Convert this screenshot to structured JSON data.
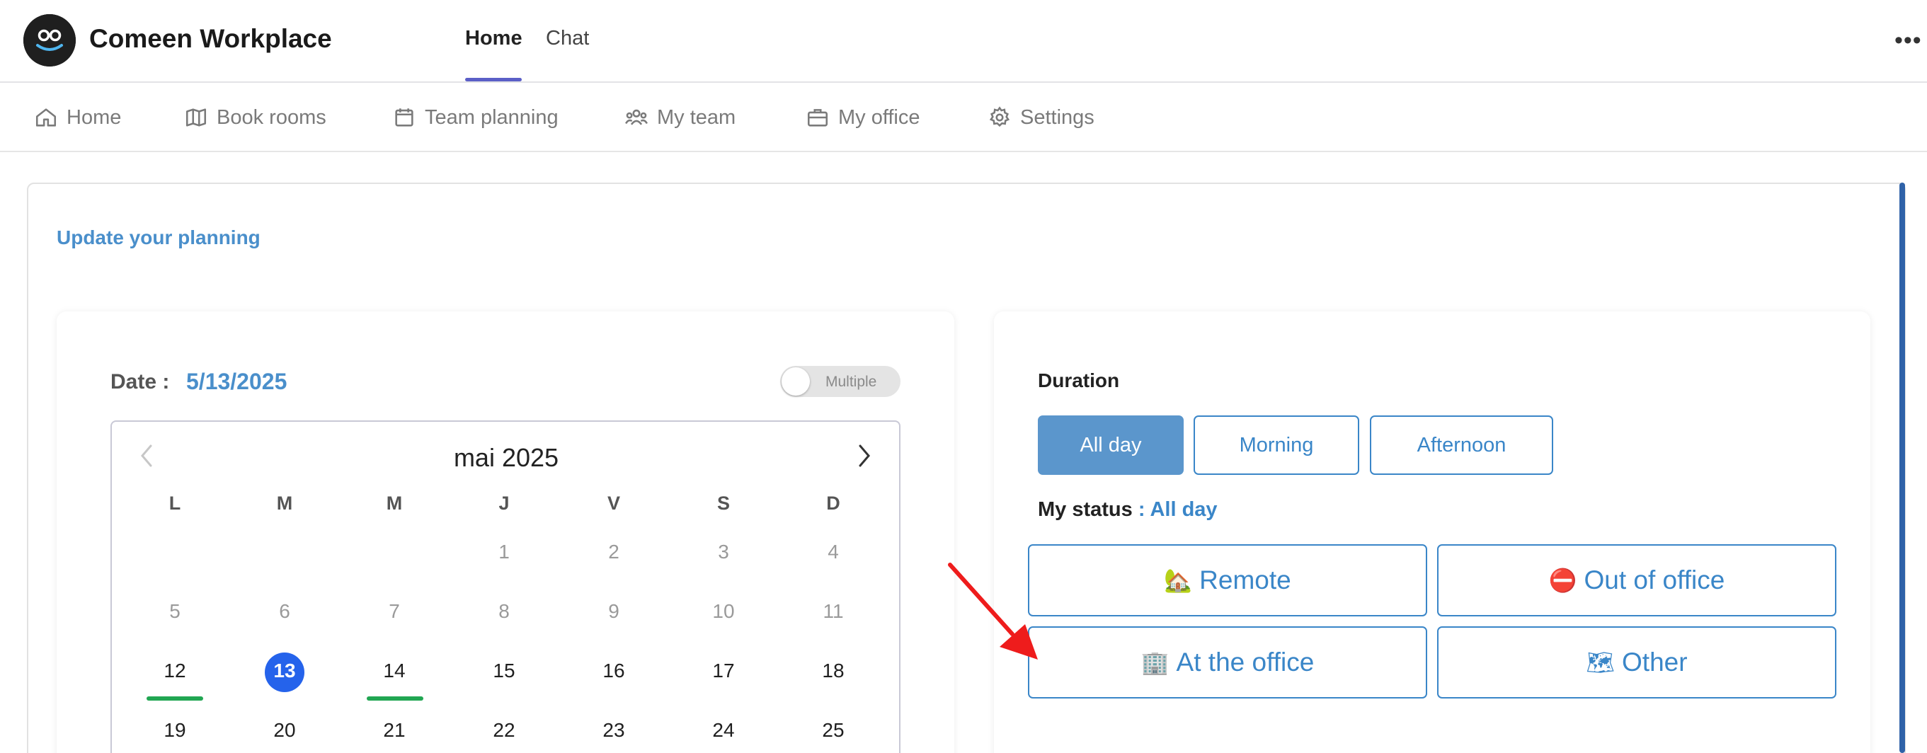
{
  "header": {
    "app_title": "Comeen Workplace",
    "tabs": [
      {
        "label": "Home",
        "active": true
      },
      {
        "label": "Chat",
        "active": false
      }
    ],
    "more_label": "•••"
  },
  "nav": {
    "items": [
      {
        "label": "Home",
        "icon": "home-icon"
      },
      {
        "label": "Book rooms",
        "icon": "map-icon"
      },
      {
        "label": "Team planning",
        "icon": "calendar-icon"
      },
      {
        "label": "My team",
        "icon": "team-icon"
      },
      {
        "label": "My office",
        "icon": "briefcase-icon"
      },
      {
        "label": "Settings",
        "icon": "gear-icon"
      }
    ]
  },
  "planning": {
    "title": "Update your planning",
    "date_label": "Date :",
    "date_value": "5/13/2025",
    "multiple_label": "Multiple",
    "multiple_enabled": false
  },
  "calendar": {
    "month_label": "mai 2025",
    "weekdays": [
      "L",
      "M",
      "M",
      "J",
      "V",
      "S",
      "D"
    ],
    "rows": [
      [
        "",
        "",
        "",
        "1",
        "2",
        "3",
        "4"
      ],
      [
        "5",
        "6",
        "7",
        "8",
        "9",
        "10",
        "11"
      ],
      [
        "12",
        "13",
        "14",
        "15",
        "16",
        "17",
        "18"
      ],
      [
        "19",
        "20",
        "21",
        "22",
        "23",
        "24",
        "25"
      ]
    ],
    "selected_day": "13",
    "marked_days": [
      "12",
      "14"
    ],
    "colors": {
      "selected": "#2563eb",
      "marker": "#21a652"
    }
  },
  "duration": {
    "title": "Duration",
    "options": [
      {
        "label": "All day",
        "active": true
      },
      {
        "label": "Morning",
        "active": false
      },
      {
        "label": "Afternoon",
        "active": false
      }
    ]
  },
  "status": {
    "label": "My status",
    "separator": " : ",
    "value": "All day",
    "options": [
      {
        "emoji": "🏡",
        "label": "Remote"
      },
      {
        "emoji": "⛔",
        "label": "Out of office"
      },
      {
        "emoji": "🏢",
        "label": "At the office"
      },
      {
        "emoji": "🗺",
        "label": "Other"
      }
    ]
  },
  "colors": {
    "accent": "#3a86c8",
    "accent_fill": "#5b96cc",
    "tab_underline": "#5b5fc7",
    "arrow": "#ee1c1c"
  }
}
